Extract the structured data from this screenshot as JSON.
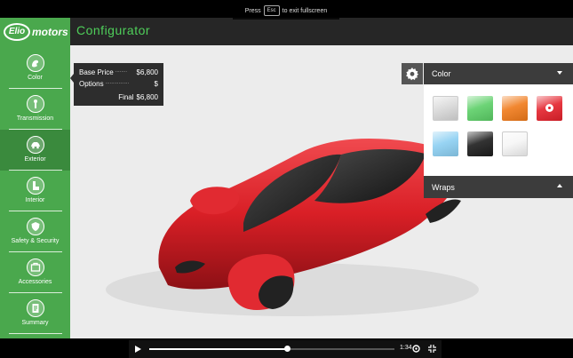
{
  "brand": {
    "logo_mark": "Elio",
    "logo_text": "motors"
  },
  "header": {
    "title": "Configurator"
  },
  "fullscreen_hint": {
    "before": "Press",
    "key": "Esc",
    "after": "to exit fullscreen"
  },
  "sidebar": {
    "active_index": 2,
    "items": [
      {
        "label": "Color",
        "icon": "paint-icon"
      },
      {
        "label": "Transmission",
        "icon": "gear-shift-icon"
      },
      {
        "label": "Exterior",
        "icon": "car-icon"
      },
      {
        "label": "Interior",
        "icon": "seat-icon"
      },
      {
        "label": "Safety & Security",
        "icon": "shield-icon"
      },
      {
        "label": "Accessories",
        "icon": "accessories-icon"
      },
      {
        "label": "Summary",
        "icon": "document-icon"
      }
    ]
  },
  "price": {
    "base_label": "Base Price",
    "base_dots": "........",
    "base_value": "$6,800",
    "options_label": "Options",
    "options_dots": "................",
    "options_value": "$",
    "final_label": "Final",
    "final_value": "$6,800"
  },
  "options_panel": {
    "color_title": "Color",
    "wraps_title": "Wraps",
    "selected_swatch": 3,
    "swatches": [
      {
        "name": "silver",
        "color": "#d9d9d9"
      },
      {
        "name": "green",
        "color": "#5ccf67"
      },
      {
        "name": "orange",
        "color": "#f07a1a"
      },
      {
        "name": "red",
        "color": "#e4212b"
      },
      {
        "name": "light-blue",
        "color": "#8ccff2"
      },
      {
        "name": "black",
        "color": "#1c1c1c"
      },
      {
        "name": "white",
        "color": "#f6f6f6"
      }
    ]
  },
  "car": {
    "body_color": "#d91f26"
  },
  "video": {
    "time": "1:34",
    "progress": 0.56
  }
}
